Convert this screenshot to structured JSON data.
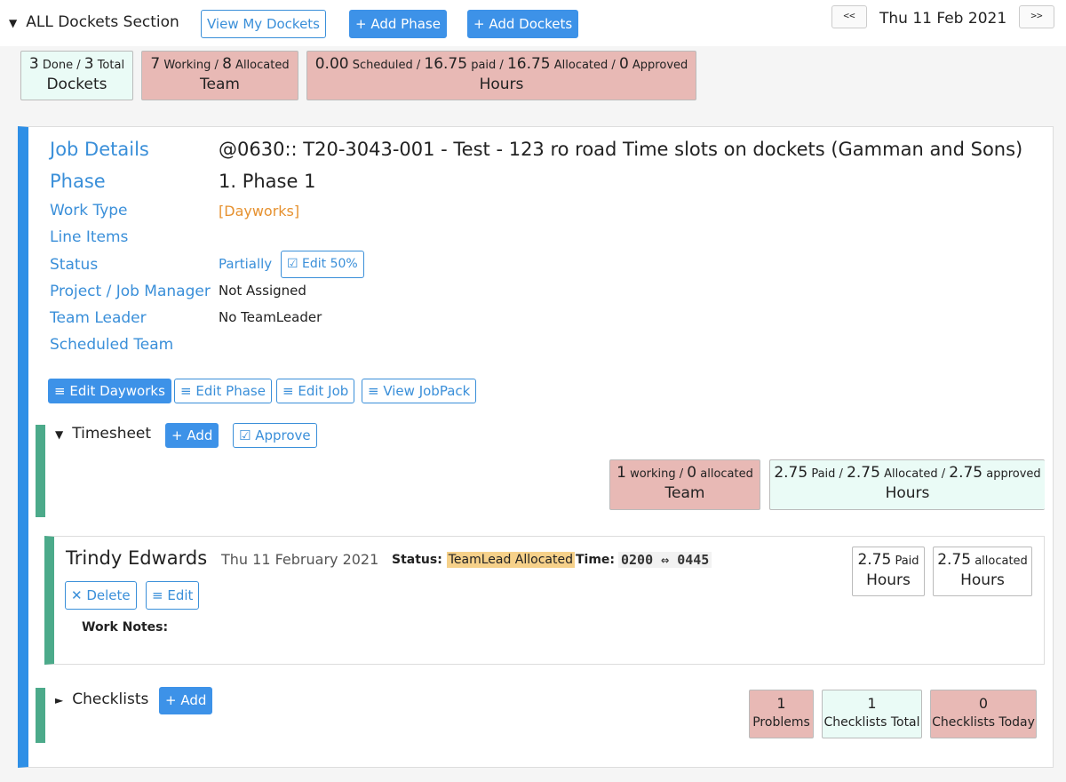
{
  "header": {
    "section_caret": "▼",
    "section_title": "ALL Dockets Section",
    "view_my_dockets": "View My Dockets",
    "add_phase": "+ Add Phase",
    "add_dockets": "+ Add Dockets",
    "prev": "<<",
    "next": ">>",
    "date": "Thu 11 Feb 2021"
  },
  "summary": {
    "dockets": {
      "done": "3",
      "done_label": "Done /",
      "total": "3",
      "total_label": "Total",
      "label": "Dockets"
    },
    "team": {
      "working": "7",
      "working_label": "Working /",
      "allocated": "8",
      "allocated_label": "Allocated",
      "label": "Team"
    },
    "hours": {
      "scheduled": "0.00",
      "scheduled_label": "Scheduled /",
      "paid": "16.75",
      "paid_label": "paid /",
      "allocated": "16.75",
      "allocated_label": "Allocated /",
      "approved": "0",
      "approved_label": "Approved",
      "label": "Hours"
    }
  },
  "job": {
    "labels": {
      "job_details": "Job Details",
      "phase": "Phase",
      "work_type": "Work Type",
      "line_items": "Line Items",
      "status": "Status",
      "manager": "Project / Job Manager",
      "team_leader": "Team Leader",
      "scheduled_team": "Scheduled Team"
    },
    "values": {
      "job_details": "@0630:: T20-3043-001 -  Test - 123 ro road Time slots on dockets (Gamman and Sons)",
      "phase": "1. Phase 1",
      "work_type": "[Dayworks]",
      "status": "Partially",
      "edit_status": "☑ Edit 50%",
      "manager": "Not Assigned",
      "team_leader": "No TeamLeader"
    },
    "actions": {
      "edit_dayworks": "≡ Edit Dayworks",
      "edit_phase": "≡ Edit Phase",
      "edit_job": "≡ Edit Job",
      "view_jobpack": "≡ View JobPack"
    }
  },
  "timesheet": {
    "caret": "▼",
    "title": "Timesheet",
    "add": "+ Add",
    "approve": "☑ Approve",
    "team": {
      "working": "1",
      "working_label": "working /",
      "allocated": "0",
      "allocated_label": "allocated",
      "label": "Team"
    },
    "hours": {
      "paid": "2.75",
      "paid_label": "Paid /",
      "allocated": "2.75",
      "allocated_label": "Allocated /",
      "approved": "2.75",
      "approved_label": "approved",
      "label": "Hours"
    }
  },
  "entry": {
    "name": "Trindy Edwards",
    "date": "Thu 11 February 2021",
    "status_label": "Status:",
    "status_value": "TeamLead Allocated",
    "time_label": "Time:",
    "time_value": "0200 ⇔ 0445",
    "delete": "✕ Delete",
    "edit": "≡ Edit",
    "work_notes": "Work Notes:",
    "paid": {
      "value": "2.75",
      "unit": "Paid",
      "label": "Hours"
    },
    "allocated": {
      "value": "2.75",
      "unit": "allocated",
      "label": "Hours"
    }
  },
  "checklists": {
    "caret": "►",
    "title": "Checklists",
    "add": "+ Add",
    "problems": {
      "value": "1",
      "label": "Problems"
    },
    "total": {
      "value": "1",
      "label": "Checklists Total"
    },
    "today": {
      "value": "0",
      "label": "Checklists Today"
    }
  },
  "colors": {
    "accent_blue": "#3d92e8",
    "link_blue": "#3a8fd9",
    "green_bar": "#4caa8a",
    "red_box": "#e8b9b5",
    "mint_box": "#eafbf6",
    "work_type_orange": "#e6912f",
    "status_highlight": "#f6d18a"
  }
}
